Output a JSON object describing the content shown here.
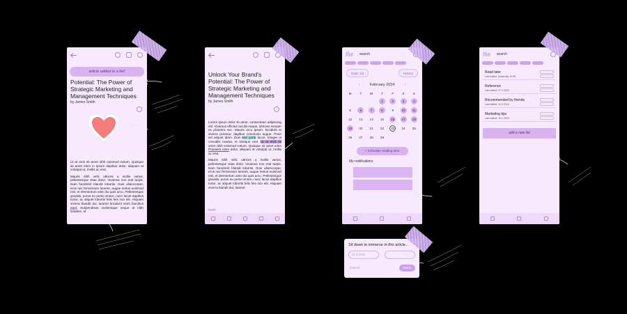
{
  "screen1": {
    "toast": "article added to a list!",
    "title": "Potential: The Power of Strategic Marketing and Management Techniques",
    "author": "by James Smith",
    "p1": "Ut at eros sit amet nibh euismod rutrum. Quisque sit amet enim in ipsum dapibus dolor, aliquam at volutpat ut, mollis ac erat.",
    "p2": "Mauris nibh velit, ultrices a mollis varius, pellentesque vitae dolor. Vivamus non erat turpis. Nam hendrerit blandit lobortis. Duis ullamcorper, eros nec fermentum laoreet, augue metus euismod nisl, et elementum ante dui quis arcu. Pellentesque gravida, purus eu porta ornare, nunc lacus dapibus tortor, ac aliquet lobortis felis feis non elit. Aliquam viverra blandit dui, laoreet tincidunt enim faucibus eget. Suspendisse scelerisque neque at nibh sodales, at"
  },
  "screen2": {
    "title": "Unlock Your Brand's Potential: The Power of Strategic Marketing and Management Techniques",
    "author": "by James Smith",
    "p1_a": "Lorem ipsum dolor sit amet, consectetur adipiscing elit. Vivamus efficitur iaculis neque, ultricies semper ex pharetra nec. Mauris arcu ipsum, tincidunt et viverra pulvinar, dapibus commodo augue. Proin vel aliquet diam. Duis ",
    "p1_hl_blue": "sed porta",
    "p1_b": " lacus. Integer ut convallis massa, et tristique erat. ",
    "p1_hl_purple": "Ut at eros sit",
    "p1_c": " amet nibh euismod rutrum. Quisque sit amet enim ",
    "p1_ul": "Praesent enim",
    "p1_d": " dolor, aliquam at volutpat ut, mollis ac erat.",
    "p2": "Mauris nibh velit, ultrices a mollis varius, pellentesque vitae dolor. Vivamus non erat turpis. Nam hendrerit blandit lobortis. Duis ullamcorper, eros nec fermentum laoreet, augue metus euismod nisl, et elementum ante dui quis arcu. Pellentesque gravida, purus eu porta ornare, nunc lacus dapibus tortor, ac aliquet lobortis felis feis non elit. Aliquam viverra blandit dui, laoreet"
  },
  "screen3": {
    "search": "search",
    "goal": "Goal: 1/3",
    "history": "History",
    "month": "February 2024",
    "weekdays": [
      "M",
      "T",
      "W",
      "T",
      "F",
      "S",
      "S"
    ],
    "weeks": [
      [
        "",
        "",
        "",
        "1",
        "2",
        "3",
        "4"
      ],
      [
        "5",
        "6",
        "7",
        "8",
        "9",
        "10",
        "11"
      ],
      [
        "12",
        "13",
        "14",
        "15",
        "16",
        "17",
        "18"
      ],
      [
        "19",
        "20",
        "21",
        "22",
        "23",
        "24",
        "25"
      ],
      [
        "26",
        "27",
        "28",
        "29",
        "",
        "",
        ""
      ]
    ],
    "schedule": "Schedule reading time",
    "notifications": "My notifications"
  },
  "screen4": {
    "search": "search",
    "items": [
      {
        "name": "Read later",
        "sub": "Last edited: yesterday 12:05"
      },
      {
        "name": "Reference",
        "sub": "Last edited: 27.2.2024"
      },
      {
        "name": "Recommended by friends",
        "sub": "Last edited: 12.2.2024"
      },
      {
        "name": "Marketing tips",
        "sub": "Last edited: 19.1.2024"
      }
    ],
    "add": "add a new list"
  },
  "modal": {
    "title": "Sit down to immerse in this article...",
    "date": "24.3.2024",
    "cancel": "Cancel",
    "done": "Done"
  },
  "colors": {
    "accent": "#d8b3f0",
    "background": "#f6eafc",
    "heart": "#f47c7c"
  }
}
